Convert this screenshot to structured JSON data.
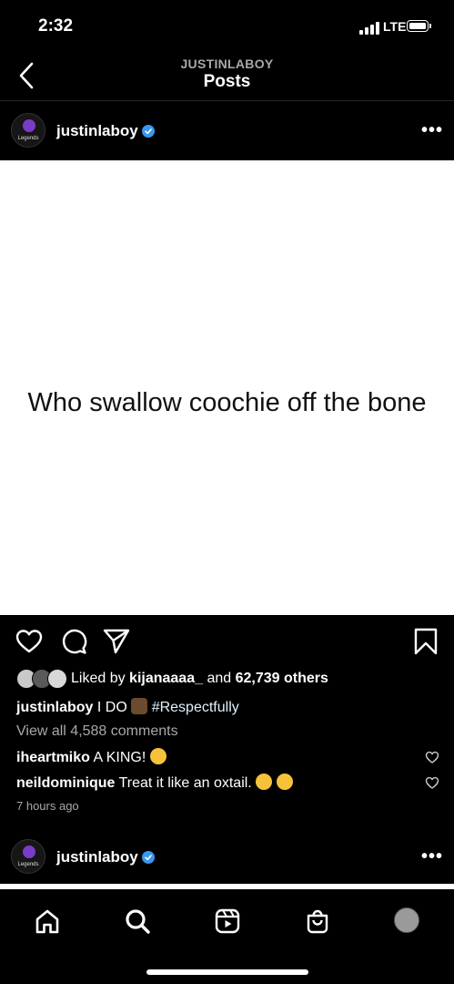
{
  "status_bar": {
    "time": "2:32",
    "network": "LTE"
  },
  "header": {
    "account": "JUSTINLABOY",
    "title": "Posts"
  },
  "post": {
    "username": "justinlaboy",
    "image_text": "Who swallow coochie off the bone",
    "liked_by_prefix": "Liked by",
    "liked_by_user": "kijanaaaa_",
    "liked_by_and": "and",
    "likes_others": "62,739 others",
    "caption_user": "justinlaboy",
    "caption_text": "I DO",
    "caption_hashtag": "#Respectfully",
    "view_comments": "View all 4,588 comments",
    "comments": [
      {
        "user": "iheartmiko",
        "text": "A KING!"
      },
      {
        "user": "neildominique",
        "text": "Treat it like an oxtail."
      }
    ],
    "timestamp": "7 hours ago"
  },
  "next_post": {
    "username": "justinlaboy"
  },
  "colors": {
    "verified": "#3897f0",
    "hashtag": "#e0f1ff",
    "muted": "#a8a8a8"
  },
  "icons": [
    "back-icon",
    "verified-icon",
    "more-icon",
    "heart-icon",
    "comment-icon",
    "share-icon",
    "bookmark-icon",
    "home-icon",
    "search-icon",
    "reels-icon",
    "shop-icon"
  ]
}
